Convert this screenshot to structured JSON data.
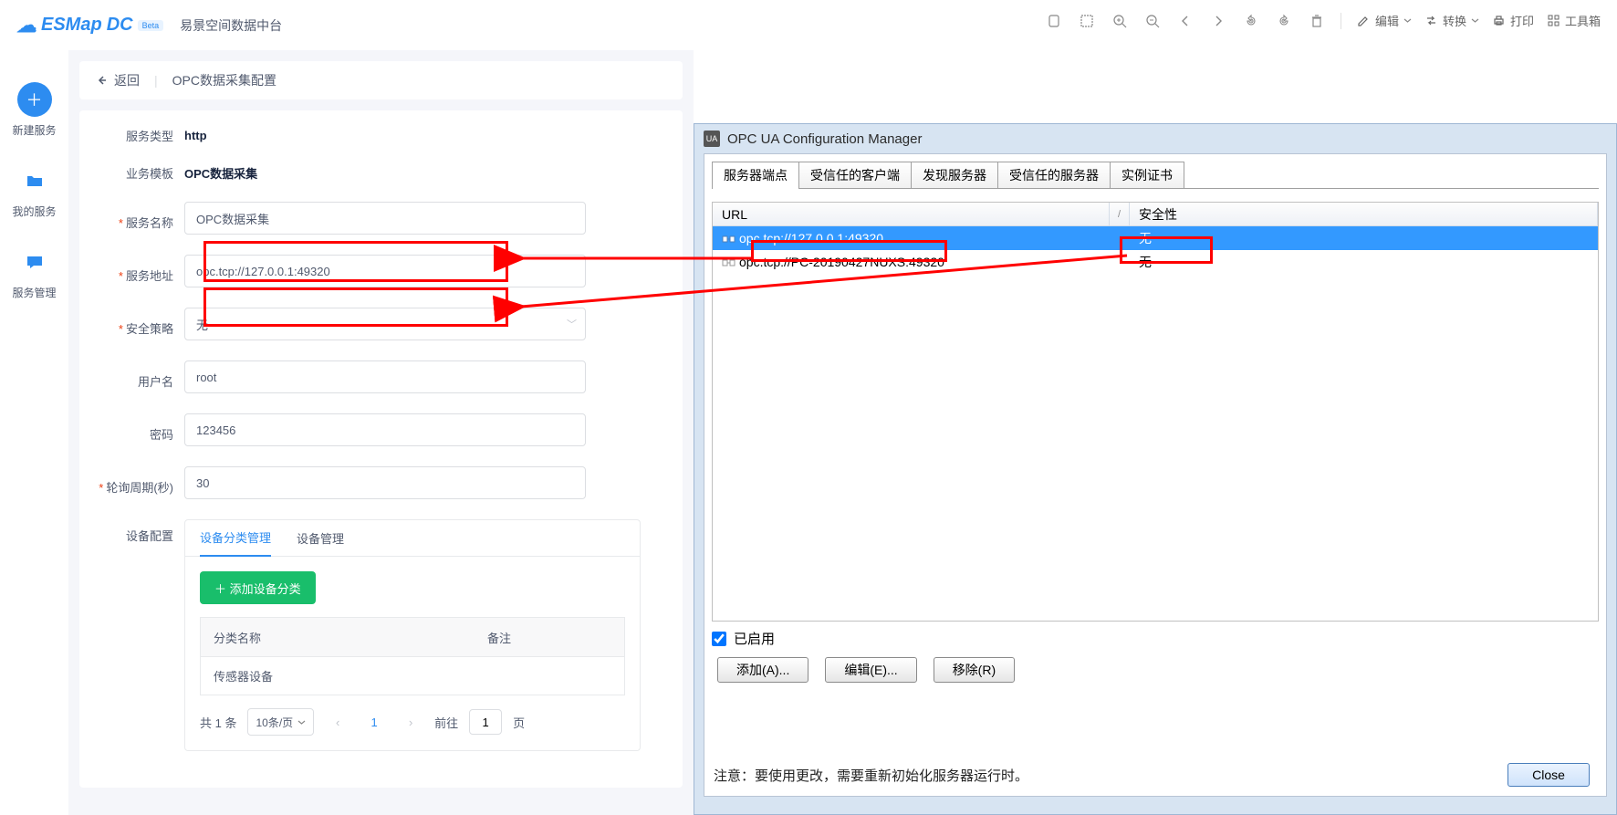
{
  "top_toolbar": {
    "edit": "编辑",
    "convert": "转换",
    "print": "打印",
    "toolbox": "工具箱"
  },
  "left_app": {
    "logo_text": "ESMap",
    "logo_dc": "DC",
    "logo_beta": "Beta",
    "app_name": "易景空间数据中台",
    "sidebar": {
      "new_service": "新建服务",
      "my_service": "我的服务",
      "service_mgmt": "服务管理"
    },
    "crumb": {
      "back": "返回",
      "title": "OPC数据采集配置"
    },
    "form": {
      "service_type_label": "服务类型",
      "service_type_value": "http",
      "biz_template_label": "业务模板",
      "biz_template_value": "OPC数据采集",
      "service_name_label": "服务名称",
      "service_name_value": "OPC数据采集",
      "service_addr_label": "服务地址",
      "service_addr_value": "opc.tcp://127.0.0.1:49320",
      "security_label": "安全策略",
      "security_value": "无",
      "username_label": "用户名",
      "username_value": "root",
      "password_label": "密码",
      "password_value": "123456",
      "poll_label": "轮询周期(秒)",
      "poll_value": "30",
      "device_label": "设备配置"
    },
    "device": {
      "tab1": "设备分类管理",
      "tab2": "设备管理",
      "add_btn": "＋ 添加设备分类",
      "col_name": "分类名称",
      "col_remark": "备注",
      "row1_name": "传感器设备"
    },
    "pager": {
      "total": "共 1 条",
      "per_page": "10条/页",
      "goto": "前往",
      "page_input": "1",
      "page_suffix": "页",
      "current": "1"
    }
  },
  "right_win": {
    "title": "OPC UA Configuration Manager",
    "tabs": {
      "t1": "服务器端点",
      "t2": "受信任的客户端",
      "t3": "发现服务器",
      "t4": "受信任的服务器",
      "t5": "实例证书"
    },
    "headers": {
      "url": "URL",
      "security": "安全性"
    },
    "rows": [
      {
        "url": "opc.tcp://127.0.0.1:49320",
        "security": "无"
      },
      {
        "url": "opc.tcp://PC-20190427NUXS:49320",
        "security": "无"
      }
    ],
    "enabled": "已启用",
    "btn_add": "添加(A)...",
    "btn_edit": "编辑(E)...",
    "btn_remove": "移除(R)",
    "note": "注意：要使用更改，需要重新初始化服务器运行时。",
    "close": "Close"
  }
}
